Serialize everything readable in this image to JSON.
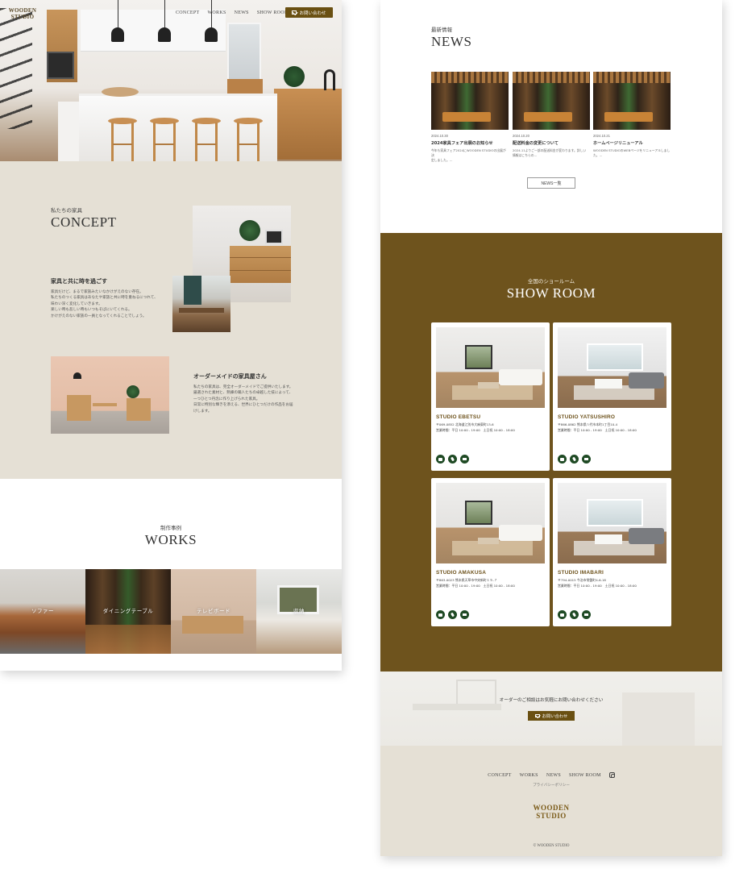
{
  "header": {
    "logo_line1": "WOODEN",
    "logo_line2": "STUDIO",
    "nav": [
      "CONCEPT",
      "WORKS",
      "NEWS",
      "SHOW ROOM"
    ],
    "contact_label": "お問い合わせ",
    "icons": [
      "instagram-icon",
      "mail-icon"
    ]
  },
  "concept": {
    "subtitle": "私たちの家具",
    "title": "CONCEPT",
    "block1_heading": "家具と共に時を過ごす",
    "block1_lines": [
      "家具だけど、まるで家族みたいなかけがえのない存在。",
      "私たちのつくる家具はあなたや家族と共に時を重ねるにつれて、",
      "味わい深く変化していきます。",
      "楽しい時も悲しい時もいつもそばにいてくれる。",
      "かけがえのない家族の一員となってくれることでしょう。"
    ],
    "block2_heading": "オーダーメイドの家具屋さん",
    "block2_lines": [
      "私たちの家具は、完全オーダーメイドでご提供いたします。",
      "厳選された素材と、熟練の職人たちの卓越した技によって、",
      "一つひとつ丹念に作り上げられた家具。",
      "日常に特別な輝きを添える、世界にひとつだけの作品をお届",
      "けします。"
    ]
  },
  "works": {
    "subtitle": "制作事例",
    "title": "WORKS",
    "tiles": [
      "ソファー",
      "ダイニングテーブル",
      "テレビボード",
      "収納"
    ]
  },
  "news": {
    "subtitle": "最新情報",
    "title": "NEWS",
    "items": [
      {
        "date": "2024.10.30",
        "title": "2024家具フェア出展のお知らせ",
        "excerpt": [
          "今年も家具フェア2024にWOODEN STUDIOの出展が決",
          "定しました。..."
        ]
      },
      {
        "date": "2024.10.20",
        "title": "配送料金の変更について",
        "excerpt": [
          "2024.11よりご一部の配送料金が変わります。詳しい",
          "情報はこちらの..."
        ]
      },
      {
        "date": "2024.10.21",
        "title": "ホームページリニューアル",
        "excerpt": [
          "WOODEN STUDIOのWEBページをリニューアルしまし",
          "た。..."
        ]
      }
    ],
    "more_label": "NEWS一覧"
  },
  "showroom": {
    "subtitle": "全国のショールーム",
    "title": "SHOW ROOM",
    "stores": [
      {
        "name": "STUDIO EBETSU",
        "address": "〒069-0852 北海道江別市大麻東町13-6",
        "hours": "営業時間：平日 10:00 - 19:00　土日祝 10:00 - 18:00"
      },
      {
        "name": "STUDIO YATSUSHIRO",
        "address": "〒866-0862 熊本県八代市本町1丁目10-4",
        "hours": "営業時間：平日 10:00 - 19:00　土日祝 10:00 - 18:00"
      },
      {
        "name": "STUDIO AMAKUSA",
        "address": "〒863-0023 熊本県天草市中央新町１５-７",
        "hours": "営業時間：平日 10:00 - 19:00　土日祝 10:00 - 18:00"
      },
      {
        "name": "STUDIO IMABARI",
        "address": "〒794-0015 今治市常盤町4-6-18",
        "hours": "営業時間：平日 10:00 - 19:00　土日祝 10:00 - 18:00"
      }
    ],
    "icons": [
      "web-icon",
      "phone-icon",
      "mail-icon"
    ]
  },
  "cta": {
    "text": "オーダーのご相談はお気軽にお問い合わせください",
    "button_label": "お問い合わせ"
  },
  "footer": {
    "nav": [
      "CONCEPT",
      "WORKS",
      "NEWS",
      "SHOW ROOM"
    ],
    "privacy": "プライバシーポリシー",
    "logo_line1": "WOODEN",
    "logo_line2": "STUDIO",
    "copyright": "© WOODEN STUDIO"
  },
  "colors": {
    "accent": "#6a5012",
    "showroom_bg": "#6e531d",
    "beige_bg": "#e5e0d5",
    "icon_green": "#1f4a24"
  }
}
